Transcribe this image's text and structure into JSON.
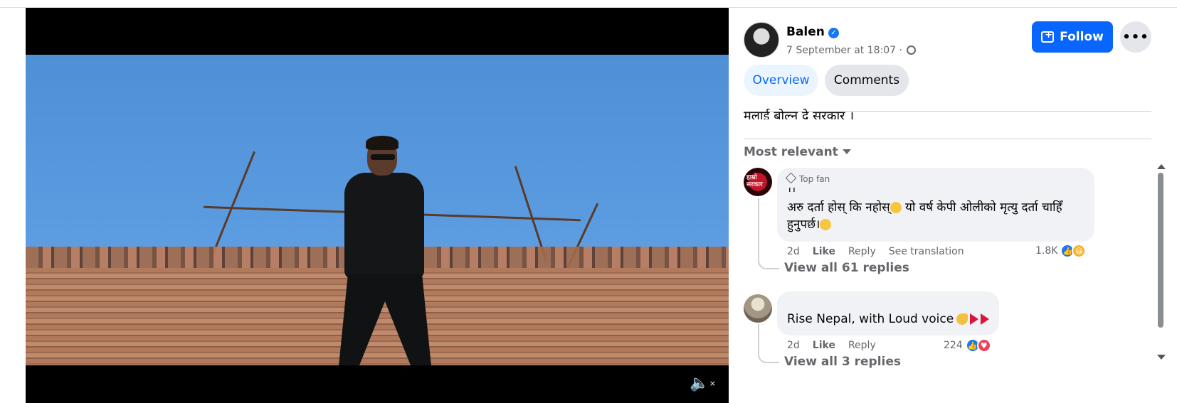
{
  "post": {
    "author": "Balen",
    "verified_icon": "verified-badge-icon",
    "timestamp": "7 September at 18:07 ·",
    "privacy_icon": "globe-icon",
    "follow_label": "Follow",
    "more_label": "•••",
    "caption": "मलाई बोल्न दे सरकार ।"
  },
  "tabs": [
    {
      "label": "Overview",
      "active": true
    },
    {
      "label": "Comments",
      "active": false
    }
  ],
  "sort_label": "Most relevant",
  "comments": [
    {
      "badge": "Top fan",
      "avatar_text": "हाम्रो सरकार",
      "cut_text": "।।",
      "text_line1": "अरु दर्ता होस् कि नहोस्",
      "text_line2": " यो वर्ष केपी ओलीको मृत्यु दर्ता चाहिँ हुनुपर्छ।",
      "time": "2d",
      "like": "Like",
      "reply": "Reply",
      "translate": "See translation",
      "reaction_count": "1.8K",
      "view_replies": "View all 61 replies"
    },
    {
      "cut_text": "",
      "text": "Rise Nepal, with Loud voice",
      "time": "2d",
      "like": "Like",
      "reply": "Reply",
      "reaction_count": "224",
      "view_replies": "View all 3 replies"
    }
  ],
  "video": {
    "mute_icon": "speaker-muted-icon",
    "mute_symbol": "🔈",
    "mute_x": "×"
  },
  "colors": {
    "accent": "#0866ff",
    "secondary_text": "#65676b",
    "bubble": "#f0f2f5"
  }
}
